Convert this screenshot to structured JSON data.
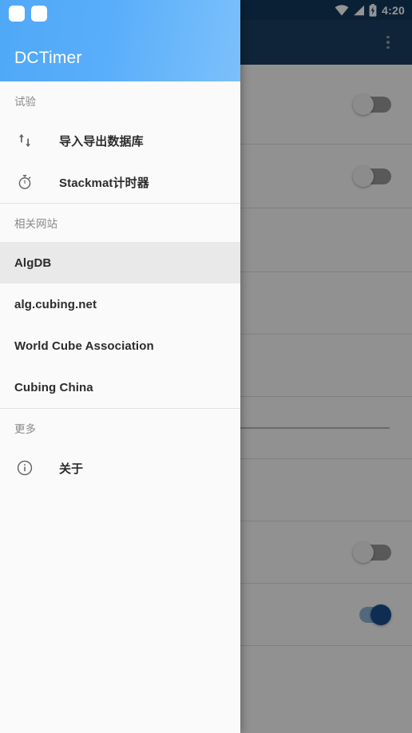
{
  "status_bar": {
    "time": "4:20",
    "icons": [
      "wifi-icon",
      "cellular-signal-icon",
      "battery-charging-icon"
    ],
    "background_color": "#123a5c"
  },
  "app_bar": {
    "nav_icon": "gear-icon",
    "overflow_icon": "overflow-menu-icon",
    "background_color": "#1b3f63"
  },
  "background_screen": {
    "name": "settings-screen",
    "scrim_color": "rgba(0,0,0,0.42)",
    "rows": [
      {
        "type": "switch",
        "state": "off",
        "height": 100
      },
      {
        "type": "switch",
        "state": "off",
        "height": 80
      },
      {
        "type": "blank",
        "state": "",
        "height": 80
      },
      {
        "type": "blank",
        "state": "",
        "height": 78
      },
      {
        "type": "blank",
        "state": "",
        "height": 78
      },
      {
        "type": "slider",
        "state": "",
        "height": 78,
        "value_percent": 7
      },
      {
        "type": "blank",
        "state": "",
        "height": 78
      },
      {
        "type": "switch",
        "state": "off",
        "height": 78
      },
      {
        "type": "switch",
        "state": "on",
        "height": 78
      }
    ],
    "accent_color": "#1b4f8f"
  },
  "drawer": {
    "header": {
      "title": "DCTimer",
      "logo_icon": "app-logo-icon",
      "gradient_start": "#4fa8f7",
      "gradient_end": "#7cc0fb"
    },
    "sections": [
      {
        "label": "试验",
        "items": [
          {
            "label": "导入导出数据库",
            "icon": "import-export-icon",
            "selected": false
          },
          {
            "label": "Stackmat计时器",
            "icon": "stopwatch-icon",
            "selected": false
          }
        ]
      },
      {
        "label": "相关网站",
        "items": [
          {
            "label": "AlgDB",
            "icon": "",
            "selected": true
          },
          {
            "label": "alg.cubing.net",
            "icon": "",
            "selected": false
          },
          {
            "label": "World Cube Association",
            "icon": "",
            "selected": false
          },
          {
            "label": "Cubing China",
            "icon": "",
            "selected": false
          }
        ]
      },
      {
        "label": "更多",
        "items": [
          {
            "label": "关于",
            "icon": "info-icon",
            "selected": false
          }
        ]
      }
    ],
    "selected_background": "#e9e9e9",
    "background": "#fafafa"
  }
}
